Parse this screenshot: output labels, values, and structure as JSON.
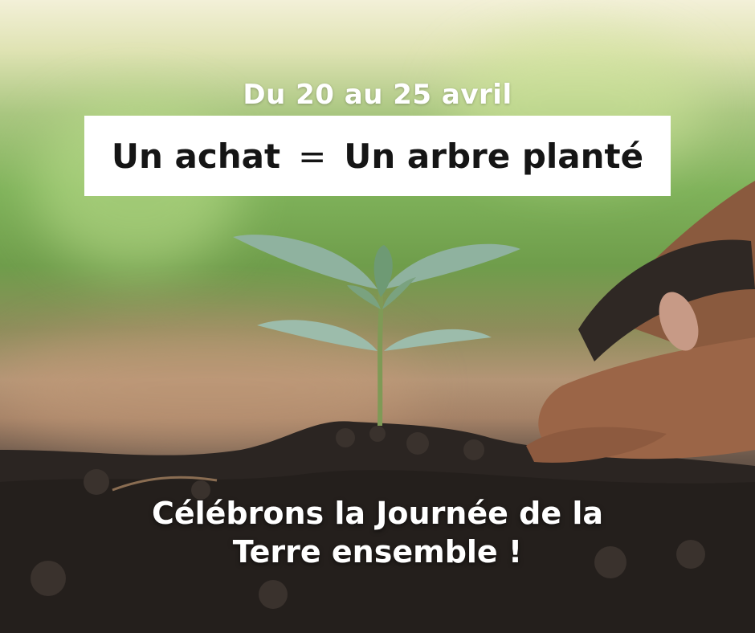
{
  "header": {
    "date_range": "Du 20 au 25 avril"
  },
  "banner": {
    "left": "Un achat",
    "equals": "=",
    "right": "Un arbre planté"
  },
  "footer": {
    "line1": "Célébrons la Journée de la",
    "line2": "Terre ensemble !"
  },
  "colors": {
    "banner_background": "#ffffff",
    "text_dark": "#151515",
    "text_light": "#ffffff",
    "leaf": "#7fa38a",
    "soil": "#2b2522"
  }
}
